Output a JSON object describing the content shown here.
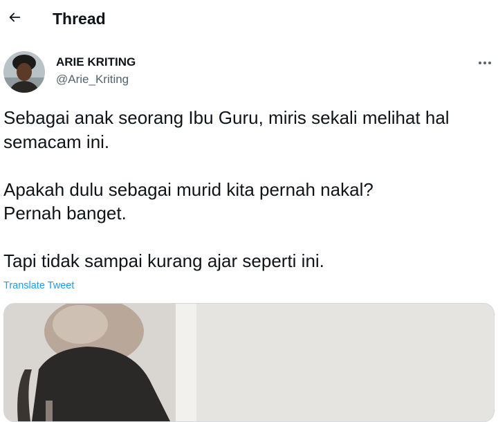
{
  "header": {
    "back_icon": "arrow-left-icon",
    "title": "Thread"
  },
  "tweet": {
    "author": {
      "display_name": "ARIE KRITING",
      "handle": "@Arie_Kriting",
      "avatar_icon": "profile-photo"
    },
    "more_icon": "more-horizontal-icon",
    "text": "Sebagai anak seorang Ibu Guru, miris sekali melihat hal semacam ini.\n\nApakah dulu sebagai murid kita pernah nakal?\nPernah banget.\n\nTapi tidak sampai kurang ajar seperti ini.",
    "translate_label": "Translate Tweet",
    "media": {
      "type": "video-thumbnail"
    }
  },
  "colors": {
    "text": "#0f1419",
    "secondary": "#536471",
    "accent": "#1d9bf0",
    "border": "#cfd9de"
  }
}
